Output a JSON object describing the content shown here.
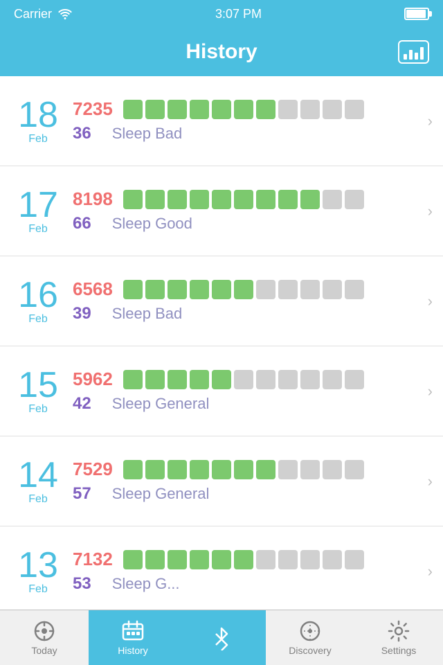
{
  "statusBar": {
    "carrier": "Carrier",
    "wifi": "📶",
    "time": "3:07 PM"
  },
  "navBar": {
    "title": "History",
    "chartIconLabel": "chart-icon"
  },
  "days": [
    {
      "number": "18",
      "month": "Feb",
      "steps": "7235",
      "greenBlocks": 7,
      "totalBlocks": 11,
      "sleepScore": "36",
      "sleepLabel": "Sleep Bad"
    },
    {
      "number": "17",
      "month": "Feb",
      "steps": "8198",
      "greenBlocks": 9,
      "totalBlocks": 11,
      "sleepScore": "66",
      "sleepLabel": "Sleep Good"
    },
    {
      "number": "16",
      "month": "Feb",
      "steps": "6568",
      "greenBlocks": 6,
      "totalBlocks": 11,
      "sleepScore": "39",
      "sleepLabel": "Sleep Bad"
    },
    {
      "number": "15",
      "month": "Feb",
      "steps": "5962",
      "greenBlocks": 5,
      "totalBlocks": 11,
      "sleepScore": "42",
      "sleepLabel": "Sleep General"
    },
    {
      "number": "14",
      "month": "Feb",
      "steps": "7529",
      "greenBlocks": 7,
      "totalBlocks": 11,
      "sleepScore": "57",
      "sleepLabel": "Sleep General"
    },
    {
      "number": "13",
      "month": "Feb",
      "steps": "7132",
      "greenBlocks": 6,
      "totalBlocks": 11,
      "sleepScore": "53",
      "sleepLabel": "Sleep G..."
    }
  ],
  "tabs": [
    {
      "id": "today",
      "label": "Today",
      "icon": "today"
    },
    {
      "id": "history",
      "label": "History",
      "icon": "history",
      "active": true
    },
    {
      "id": "bluetooth",
      "label": "",
      "icon": "bluetooth",
      "active": false,
      "center": true
    },
    {
      "id": "discovery",
      "label": "Discovery",
      "icon": "discovery"
    },
    {
      "id": "settings",
      "label": "Settings",
      "icon": "settings"
    }
  ]
}
